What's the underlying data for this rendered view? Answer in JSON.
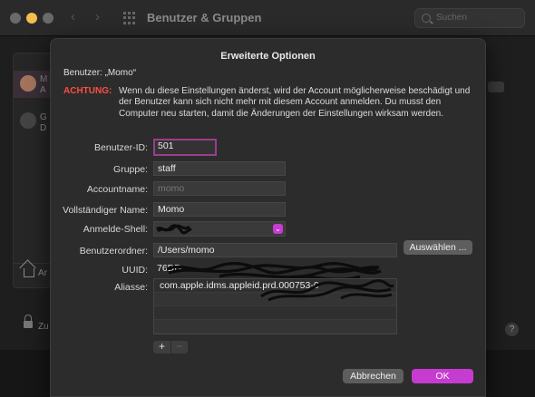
{
  "window": {
    "title": "Benutzer & Gruppen",
    "search_placeholder": "Suchen"
  },
  "sidebar_peek": {
    "row1_initial": "M",
    "row1_sub": "A",
    "row2_initial": "G",
    "row2_sub": "D",
    "home_letter": "Ar",
    "lock_letters": "Zu"
  },
  "sheet": {
    "title": "Erweiterte Optionen",
    "user_line": "Benutzer: „Momo“",
    "warning_label": "ACHTUNG:",
    "warning_text": "Wenn du diese Einstellungen änderst, wird der Account möglicherweise beschädigt und der Benutzer kann sich nicht mehr mit diesem Account anmelden. Du musst den Computer neu starten, damit die Änderungen der Einstellungen wirksam werden.",
    "fields": {
      "user_id_label": "Benutzer-ID:",
      "user_id_value": "501",
      "group_label": "Gruppe:",
      "group_value": "staff",
      "account_name_label": "Accountname:",
      "account_name_value": "momo",
      "full_name_label": "Vollständiger Name:",
      "full_name_value": "Momo",
      "login_shell_label": "Anmelde-Shell:",
      "login_shell_value": "/bin/zsh",
      "home_folder_label": "Benutzerordner:",
      "home_folder_value": "/Users/momo",
      "choose_button": "Auswählen ...",
      "uuid_label": "UUID:",
      "uuid_value": "76DD",
      "aliases_label": "Aliasse:",
      "aliases": [
        "com.apple.idms.appleid.prd.000753-0"
      ]
    },
    "plus": "+",
    "minus": "−",
    "cancel_button": "Abbrechen",
    "ok_button": "OK"
  },
  "colors": {
    "accent": "#c63bd0",
    "warning": "#ff4d42",
    "focus_ring": "#9a3d8f"
  }
}
